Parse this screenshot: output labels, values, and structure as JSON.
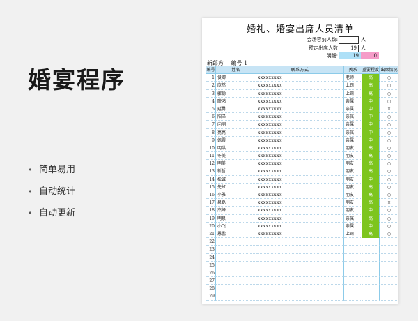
{
  "slide": {
    "title": "婚宴程序",
    "features": [
      "简单易用",
      "自动统计",
      "自动更新"
    ]
  },
  "sheet": {
    "title": "婚礼、婚宴出席人员清单",
    "capacity_label": "会场容纳人数:",
    "capacity_value": "",
    "capacity_unit": "人",
    "planned_label": "预定出席人数",
    "planned_value": "19",
    "planned_unit": "人",
    "detail_label": "明细:",
    "detail_blue": "19",
    "detail_pink": "0",
    "party_label": "新郎方",
    "number_label": "编号",
    "number_value": "1",
    "headers": [
      "编号",
      "姓名",
      "联系方式",
      "关系",
      "重要程度",
      "出席情况"
    ],
    "rows": [
      {
        "no": "1",
        "name": "俊卿",
        "contact": "xxxxxxxxx",
        "rel": "老师",
        "level": "高",
        "attend": "○"
      },
      {
        "no": "2",
        "name": "欣然",
        "contact": "xxxxxxxxx",
        "rel": "上司",
        "level": "高",
        "attend": "○"
      },
      {
        "no": "3",
        "name": "骤聪",
        "contact": "xxxxxxxxx",
        "rel": "上司",
        "level": "高",
        "attend": "○"
      },
      {
        "no": "4",
        "name": "映鸿",
        "contact": "xxxxxxxxx",
        "rel": "亲属",
        "level": "中",
        "attend": "○"
      },
      {
        "no": "5",
        "name": "延勇",
        "contact": "xxxxxxxxx",
        "rel": "亲属",
        "level": "中",
        "attend": "×"
      },
      {
        "no": "6",
        "name": "阳泽",
        "contact": "xxxxxxxxx",
        "rel": "亲属",
        "level": "中",
        "attend": "○"
      },
      {
        "no": "7",
        "name": "向明",
        "contact": "xxxxxxxxx",
        "rel": "亲属",
        "level": "中",
        "attend": "○"
      },
      {
        "no": "8",
        "name": "亮亮",
        "contact": "xxxxxxxxx",
        "rel": "亲属",
        "level": "中",
        "attend": "○"
      },
      {
        "no": "9",
        "name": "佩霞",
        "contact": "xxxxxxxxx",
        "rel": "亲属",
        "level": "中",
        "attend": "○"
      },
      {
        "no": "10",
        "name": "明洪",
        "contact": "xxxxxxxxx",
        "rel": "朋友",
        "level": "高",
        "attend": "○"
      },
      {
        "no": "11",
        "name": "冬美",
        "contact": "xxxxxxxxx",
        "rel": "朋友",
        "level": "高",
        "attend": "○"
      },
      {
        "no": "12",
        "name": "明美",
        "contact": "xxxxxxxxx",
        "rel": "朋友",
        "level": "高",
        "attend": "○"
      },
      {
        "no": "13",
        "name": "新哲",
        "contact": "xxxxxxxxx",
        "rel": "朋友",
        "level": "高",
        "attend": "○"
      },
      {
        "no": "14",
        "name": "松诚",
        "contact": "xxxxxxxxx",
        "rel": "朋友",
        "level": "中",
        "attend": "○"
      },
      {
        "no": "15",
        "name": "先虹",
        "contact": "xxxxxxxxx",
        "rel": "朋友",
        "level": "高",
        "attend": "○"
      },
      {
        "no": "16",
        "name": "小雅",
        "contact": "xxxxxxxxx",
        "rel": "朋友",
        "level": "高",
        "attend": "○"
      },
      {
        "no": "17",
        "name": "泉磊",
        "contact": "xxxxxxxxx",
        "rel": "朋友",
        "level": "高",
        "attend": "×"
      },
      {
        "no": "18",
        "name": "杰峰",
        "contact": "xxxxxxxxx",
        "rel": "朋友",
        "level": "中",
        "attend": "○"
      },
      {
        "no": "19",
        "name": "明泉",
        "contact": "xxxxxxxxx",
        "rel": "亲属",
        "level": "高",
        "attend": "○"
      },
      {
        "no": "20",
        "name": "小飞",
        "contact": "xxxxxxxxx",
        "rel": "亲属",
        "level": "中",
        "attend": "○"
      },
      {
        "no": "21",
        "name": "恩鹏",
        "contact": "xxxxxxxxx",
        "rel": "上司",
        "level": "高",
        "attend": "○"
      },
      {
        "no": "22",
        "name": "",
        "contact": "",
        "rel": "",
        "level": "",
        "attend": ""
      },
      {
        "no": "23",
        "name": "",
        "contact": "",
        "rel": "",
        "level": "",
        "attend": ""
      },
      {
        "no": "24",
        "name": "",
        "contact": "",
        "rel": "",
        "level": "",
        "attend": ""
      },
      {
        "no": "25",
        "name": "",
        "contact": "",
        "rel": "",
        "level": "",
        "attend": ""
      },
      {
        "no": "26",
        "name": "",
        "contact": "",
        "rel": "",
        "level": "",
        "attend": ""
      },
      {
        "no": "27",
        "name": "",
        "contact": "",
        "rel": "",
        "level": "",
        "attend": ""
      },
      {
        "no": "28",
        "name": "",
        "contact": "",
        "rel": "",
        "level": "",
        "attend": ""
      },
      {
        "no": "29",
        "name": "",
        "contact": "",
        "rel": "",
        "level": "",
        "attend": ""
      }
    ]
  }
}
